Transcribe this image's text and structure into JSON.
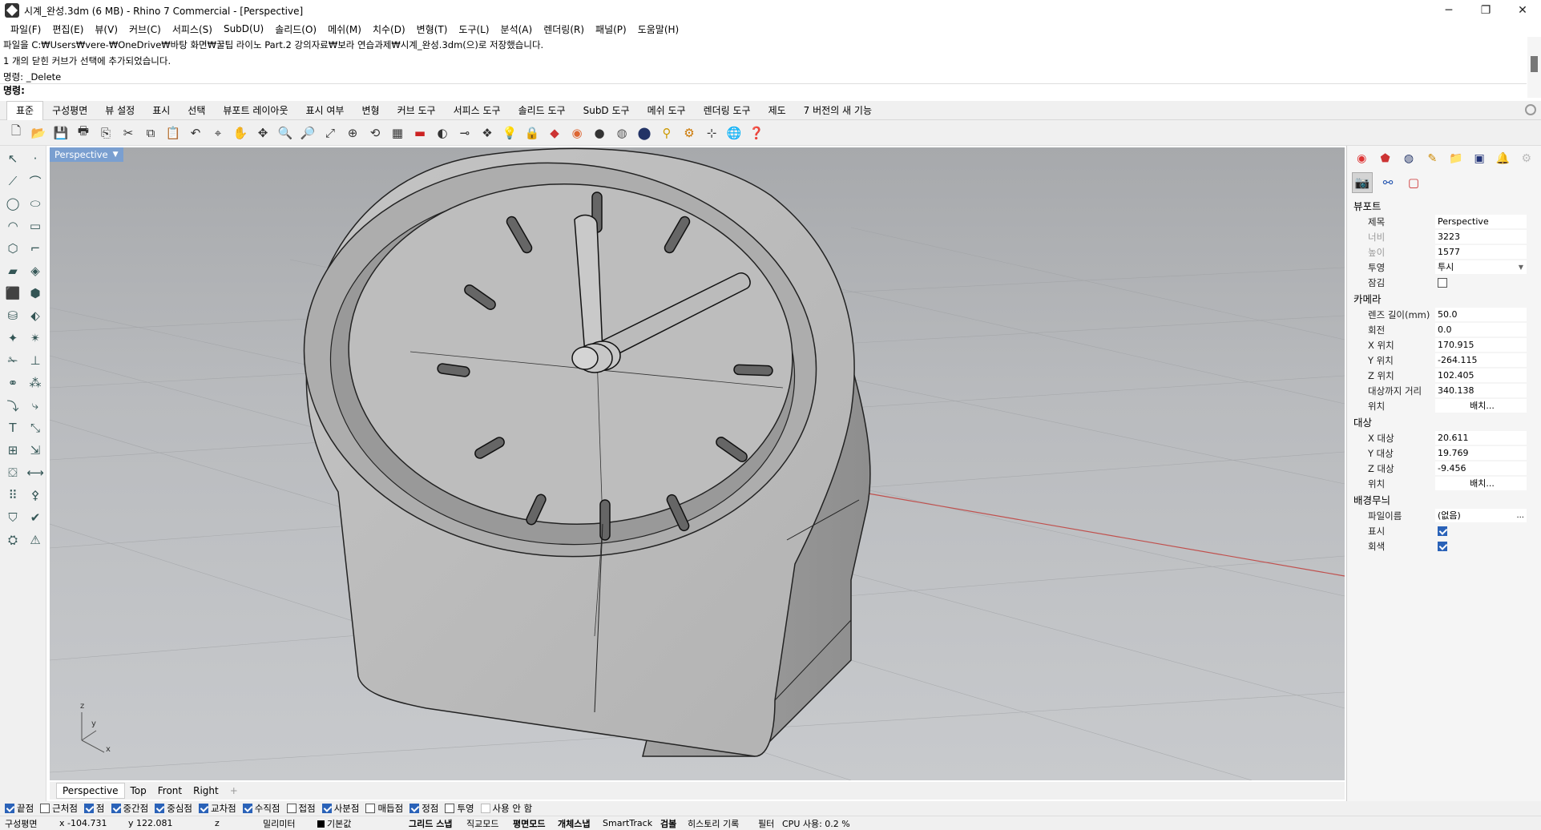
{
  "window": {
    "title": "시계_완성.3dm (6 MB) - Rhino 7 Commercial - [Perspective]",
    "minimize": "─",
    "restore": "❐",
    "close": "✕"
  },
  "menu": [
    "파일(F)",
    "편집(E)",
    "뷰(V)",
    "커브(C)",
    "서피스(S)",
    "SubD(U)",
    "솔리드(O)",
    "메쉬(M)",
    "치수(D)",
    "변형(T)",
    "도구(L)",
    "분석(A)",
    "렌더링(R)",
    "패널(P)",
    "도움말(H)"
  ],
  "command_history": [
    "파일을 C:₩Users₩vere-₩OneDrive₩바탕 화면₩꿀팁 라이노 Part.2 강의자료₩보라 연습과제₩시계_완성.3dm(으)로 저장했습니다.",
    "1 개의 닫힌 커브가 선택에 추가되었습니다.",
    "명령: _Delete"
  ],
  "command_prompt": "명령:",
  "toolbar_tabs": [
    "표준",
    "구성평면",
    "뷰 설정",
    "표시",
    "선택",
    "뷰포트 레이아웃",
    "표시 여부",
    "변형",
    "커브 도구",
    "서피스 도구",
    "솔리드 도구",
    "SubD 도구",
    "메쉬 도구",
    "렌더링 도구",
    "제도",
    "7 버전의 새 기능"
  ],
  "toolbar_icons": [
    "new-file",
    "open-file",
    "save",
    "print",
    "import",
    "cut",
    "copy",
    "paste",
    "undo",
    "select",
    "pan",
    "rotate-view",
    "zoom-dynamic",
    "zoom-window",
    "zoom-extents",
    "zoom-selected",
    "undo-view",
    "four-views",
    "car",
    "tilt",
    "plane",
    "layers",
    "light",
    "lock",
    "material",
    "color-wheel",
    "shaded",
    "rendered",
    "rendering",
    "lamp",
    "gears",
    "dimension",
    "globe",
    "help"
  ],
  "viewport": {
    "name": "Perspective",
    "axis": {
      "x": "x",
      "y": "y",
      "z": "z"
    }
  },
  "viewport_tabs": [
    "Perspective",
    "Top",
    "Front",
    "Right",
    "+"
  ],
  "panel": {
    "tab_icons": [
      "color-icon",
      "material-icon",
      "environment-icon",
      "brush-icon",
      "folder-icon",
      "display-icon",
      "bell-icon",
      "more-icon"
    ],
    "sub_icons": [
      "camera-icon",
      "link-icon",
      "viewport-frame-icon"
    ],
    "viewport_section": "뷰포트",
    "viewport_rows": [
      {
        "label": "제목",
        "value": "Perspective",
        "dim": false
      },
      {
        "label": "너비",
        "value": "3223",
        "dim": true
      },
      {
        "label": "높이",
        "value": "1577",
        "dim": true
      },
      {
        "label": "투영",
        "value": "투시",
        "dim": false
      }
    ],
    "lock_label": "잠김",
    "camera_section": "카메라",
    "camera_rows": [
      {
        "label": "렌즈 길이(mm)",
        "value": "50.0"
      },
      {
        "label": "회전",
        "value": "0.0"
      },
      {
        "label": "X 위치",
        "value": "170.915"
      },
      {
        "label": "Y 위치",
        "value": "-264.115"
      },
      {
        "label": "Z 위치",
        "value": "102.405"
      },
      {
        "label": "대상까지 거리",
        "value": "340.138"
      }
    ],
    "camera_position_label": "위치",
    "camera_position_button": "배치...",
    "target_section": "대상",
    "target_rows": [
      {
        "label": "X 대상",
        "value": "20.611"
      },
      {
        "label": "Y 대상",
        "value": "19.769"
      },
      {
        "label": "Z 대상",
        "value": "-9.456"
      }
    ],
    "target_position_label": "위치",
    "target_position_button": "배치...",
    "wallpaper_section": "배경무늬",
    "filename_label": "파일이름",
    "filename_value": "(없음)",
    "filename_button": "...",
    "show_label": "표시",
    "gray_label": "회색"
  },
  "osnaps": [
    {
      "label": "끝점",
      "checked": true
    },
    {
      "label": "근처점",
      "checked": false
    },
    {
      "label": "점",
      "checked": true
    },
    {
      "label": "중간점",
      "checked": true
    },
    {
      "label": "중심점",
      "checked": true
    },
    {
      "label": "교차점",
      "checked": true
    },
    {
      "label": "수직점",
      "checked": true
    },
    {
      "label": "접점",
      "checked": false
    },
    {
      "label": "사분점",
      "checked": true
    },
    {
      "label": "매듭점",
      "checked": false
    },
    {
      "label": "정점",
      "checked": true
    },
    {
      "label": "투영",
      "checked": false
    },
    {
      "label": "사용 안 함",
      "checked": false
    }
  ],
  "status": {
    "cplane": "구성평면",
    "x": "x -104.731",
    "y": "y 122.081",
    "z": "z",
    "units": "밀리미터",
    "layer": "기본값",
    "grid_snap": "그리드 스냅",
    "ortho": "직교모드",
    "planar": "평면모드",
    "osnap": "개체스냅",
    "smarttrack": "SmartTrack",
    "gumball": "검볼",
    "history": "히스토리 기록",
    "filter": "필터",
    "cpu": "CPU 사용: 0.2 %"
  },
  "colors": {
    "viewport_label_bg": "#7a9fd0",
    "model_fill": "#b8b8b8",
    "checkbox_on": "#2a62b8"
  }
}
